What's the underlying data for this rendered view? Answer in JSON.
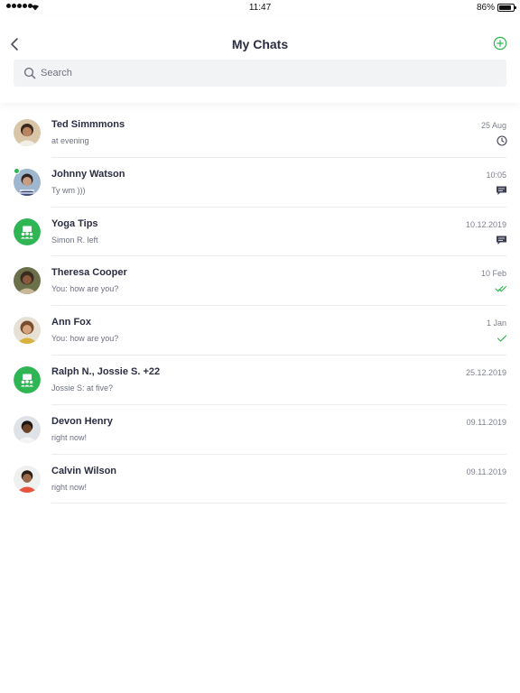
{
  "status_bar": {
    "time": "11:47",
    "battery": "86%",
    "battery_level": 0.86,
    "icons": [
      "signal-dots-icon",
      "wifi-icon",
      "battery-icon"
    ]
  },
  "header": {
    "title": "My Chats",
    "back_icon": "chevron-left-icon",
    "add_icon": "plus-circle-icon",
    "accent_color": "#2fb553"
  },
  "search": {
    "placeholder": "Search",
    "value": "",
    "icon": "search-icon"
  },
  "chats": [
    {
      "name": "Ted Simmmons",
      "preview": "at evening",
      "date": "25 Aug",
      "status_icon": "clock-icon",
      "avatar": "photo",
      "online": false
    },
    {
      "name": "Johnny Watson",
      "preview": "Ty wm )))",
      "date": "10:05",
      "status_icon": "message-icon",
      "avatar": "photo",
      "online": true
    },
    {
      "name": "Yoga Tips",
      "preview": "Simon R. left",
      "date": "10.12.2019",
      "status_icon": "message-icon",
      "avatar": "group-icon",
      "online": false
    },
    {
      "name": "Theresa Cooper",
      "preview": "You: how are you?",
      "date": "10 Feb",
      "status_icon": "double-check-icon",
      "avatar": "photo",
      "online": false
    },
    {
      "name": "Ann Fox",
      "preview": "You: how are you?",
      "date": "1 Jan",
      "status_icon": "check-icon",
      "avatar": "photo",
      "online": false
    },
    {
      "name": "Ralph N., Jossie  S. +22",
      "preview": "Jossie S: at five?",
      "date": "25.12.2019",
      "status_icon": "",
      "avatar": "group-icon",
      "online": false
    },
    {
      "name": "Devon Henry",
      "preview": "right now!",
      "date": "09.11.2019",
      "status_icon": "",
      "avatar": "photo",
      "online": false
    },
    {
      "name": "Calvin Wilson",
      "preview": "right now!",
      "date": "09.11.2019",
      "status_icon": "",
      "avatar": "photo",
      "online": false
    }
  ],
  "colors": {
    "title_text": "#2b2d42",
    "secondary_text": "#6d7080",
    "green": "#2fb553",
    "search_bg": "#f2f3f5"
  }
}
